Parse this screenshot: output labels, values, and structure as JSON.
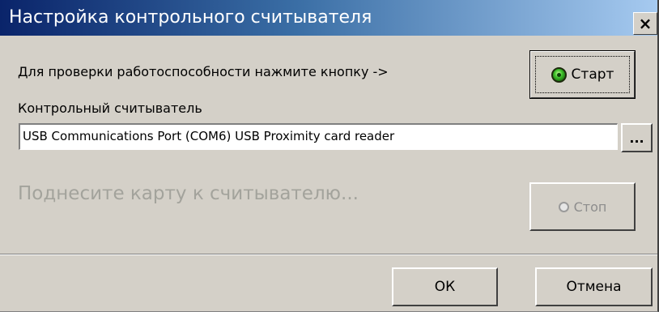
{
  "window": {
    "title": "Настройка контрольного считывателя",
    "close_label": "×"
  },
  "check": {
    "instruction": "Для проверки работоспособности нажмите кнопку ->",
    "start_label": "Старт"
  },
  "reader": {
    "label": "Контрольный считыватель",
    "value": "USB Communications Port (COM6) USB Proximity card reader",
    "browse_label": "..."
  },
  "status": {
    "prompt": "Поднесите карту к считывателю...",
    "stop_label": "Стоп"
  },
  "footer": {
    "ok_label": "ОК",
    "cancel_label": "Отмена"
  }
}
